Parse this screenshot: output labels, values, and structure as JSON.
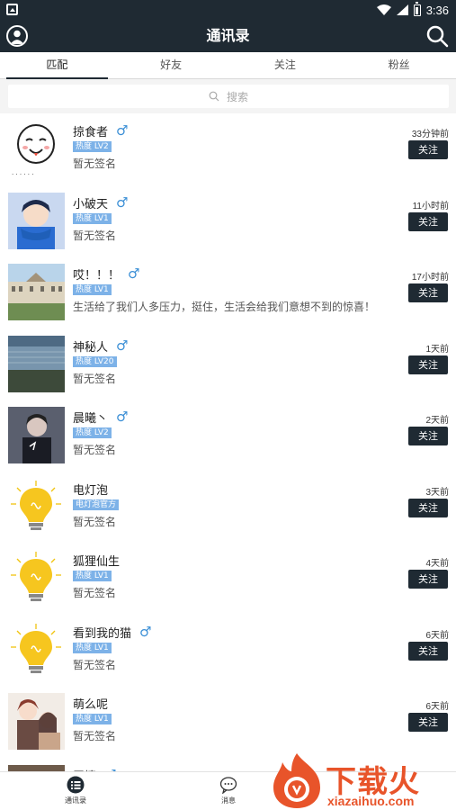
{
  "status_bar": {
    "time": "3:36"
  },
  "header": {
    "title": "通讯录"
  },
  "tabs": [
    {
      "label": "匹配",
      "active": true
    },
    {
      "label": "好友",
      "active": false
    },
    {
      "label": "关注",
      "active": false
    },
    {
      "label": "粉丝",
      "active": false
    }
  ],
  "search": {
    "placeholder": "搜索"
  },
  "items": [
    {
      "name": "掠食者",
      "gender": "♂",
      "badge": "热度 LV2",
      "signature": "暂无签名",
      "time": "33分钟前",
      "button": "关注",
      "avatar": "meme-face"
    },
    {
      "name": "小破天",
      "gender": "♂",
      "badge": "热度 LV1",
      "signature": "暂无签名",
      "time": "11小时前",
      "button": "关注",
      "avatar": "anime-boy"
    },
    {
      "name": "哎！！！",
      "gender": "♂",
      "badge": "热度 LV1",
      "signature": "生活给了我们人多压力，挺住，生活会给我们意想不到的惊喜！",
      "time": "17小时前",
      "button": "关注",
      "avatar": "palace"
    },
    {
      "name": "神秘人",
      "gender": "♂",
      "badge": "热度 LV20",
      "signature": "暂无签名",
      "time": "1天前",
      "button": "关注",
      "avatar": "stadium"
    },
    {
      "name": "晨曦丶",
      "gender": "♂",
      "badge": "热度 LV2",
      "signature": "暂无签名",
      "time": "2天前",
      "button": "关注",
      "avatar": "dark-boy"
    },
    {
      "name": "电灯泡",
      "gender": "",
      "badge": "电灯泡官方",
      "signature": "暂无签名",
      "time": "3天前",
      "button": "关注",
      "avatar": "bulb"
    },
    {
      "name": "狐狸仙生",
      "gender": "",
      "badge": "热度 LV1",
      "signature": "暂无签名",
      "time": "4天前",
      "button": "关注",
      "avatar": "bulb"
    },
    {
      "name": "看到我的猫",
      "gender": "♂",
      "badge": "热度 LV1",
      "signature": "暂无签名",
      "time": "6天前",
      "button": "关注",
      "avatar": "bulb"
    },
    {
      "name": "萌么呢",
      "gender": "",
      "badge": "热度 LV1",
      "signature": "暂无签名",
      "time": "6天前",
      "button": "关注",
      "avatar": "couple"
    },
    {
      "name": "无情",
      "gender": "♂",
      "badge": "",
      "signature": "",
      "time": "",
      "button": "",
      "avatar": "partial"
    }
  ],
  "bottom_nav": [
    {
      "label": "通讯录",
      "icon": "list-icon"
    },
    {
      "label": "消息",
      "icon": "chat-icon"
    }
  ],
  "watermark": {
    "brand": "下载火",
    "url": "xiazaihuo.com"
  },
  "colors": {
    "header_bg": "#1f2a33",
    "badge": "#7db2e8",
    "gender": "#3b8fd6",
    "watermark": "#e8542a"
  }
}
